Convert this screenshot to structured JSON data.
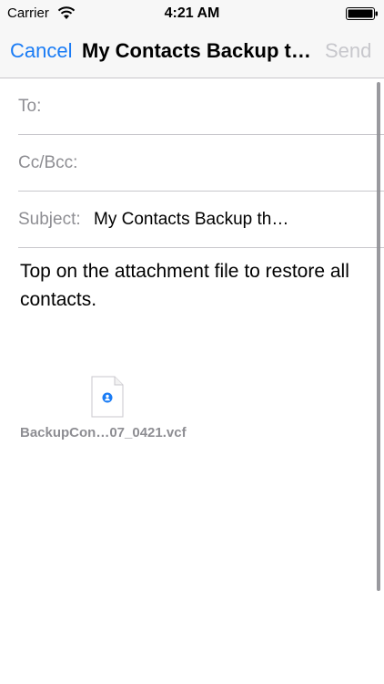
{
  "status_bar": {
    "carrier": "Carrier",
    "time": "4:21 AM",
    "wifi_icon": "wifi-icon",
    "battery_icon": "battery-icon"
  },
  "nav": {
    "cancel_label": "Cancel",
    "title": "My Contacts Backup t…",
    "send_label": "Send",
    "accent_color": "#1a7cf5",
    "disabled_color": "#c7c7cc"
  },
  "fields": {
    "to_label": "To:",
    "to_value": "",
    "ccbcc_label": "Cc/Bcc:",
    "ccbcc_value": "",
    "subject_label": "Subject:",
    "subject_value": "My Contacts Backup th…"
  },
  "body": {
    "text": "Top on the attachment file to restore all contacts."
  },
  "attachment": {
    "icon": "vcf-file-icon",
    "filename": "BackupCon…07_0421.vcf"
  }
}
